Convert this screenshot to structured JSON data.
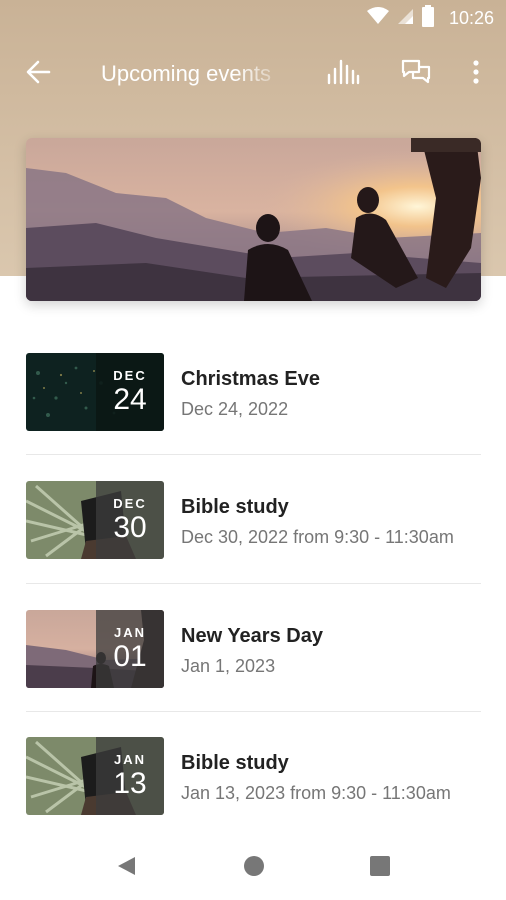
{
  "status_bar": {
    "time": "10:26"
  },
  "toolbar": {
    "title": "Upcoming events"
  },
  "events": [
    {
      "title": "Christmas Eve",
      "subtitle": "Dec 24, 2022",
      "month": "DEC",
      "day": "24"
    },
    {
      "title": "Bible study",
      "subtitle": "Dec 30, 2022 from 9:30 - 11:30am",
      "month": "DEC",
      "day": "30"
    },
    {
      "title": "New Years Day",
      "subtitle": "Jan 1, 2023",
      "month": "JAN",
      "day": "01"
    },
    {
      "title": "Bible study",
      "subtitle": "Jan 13, 2023 from 9:30 - 11:30am",
      "month": "JAN",
      "day": "13"
    }
  ],
  "icons": {
    "back": "arrow-back-icon",
    "activity": "activity-icon",
    "chat": "chat-icon",
    "more": "more-vert-icon",
    "wifi": "wifi-icon",
    "signal": "signal-icon",
    "battery": "battery-icon"
  },
  "colors": {
    "header": "#c9b296",
    "title_text": "#222222",
    "subtitle_text": "#767676"
  }
}
